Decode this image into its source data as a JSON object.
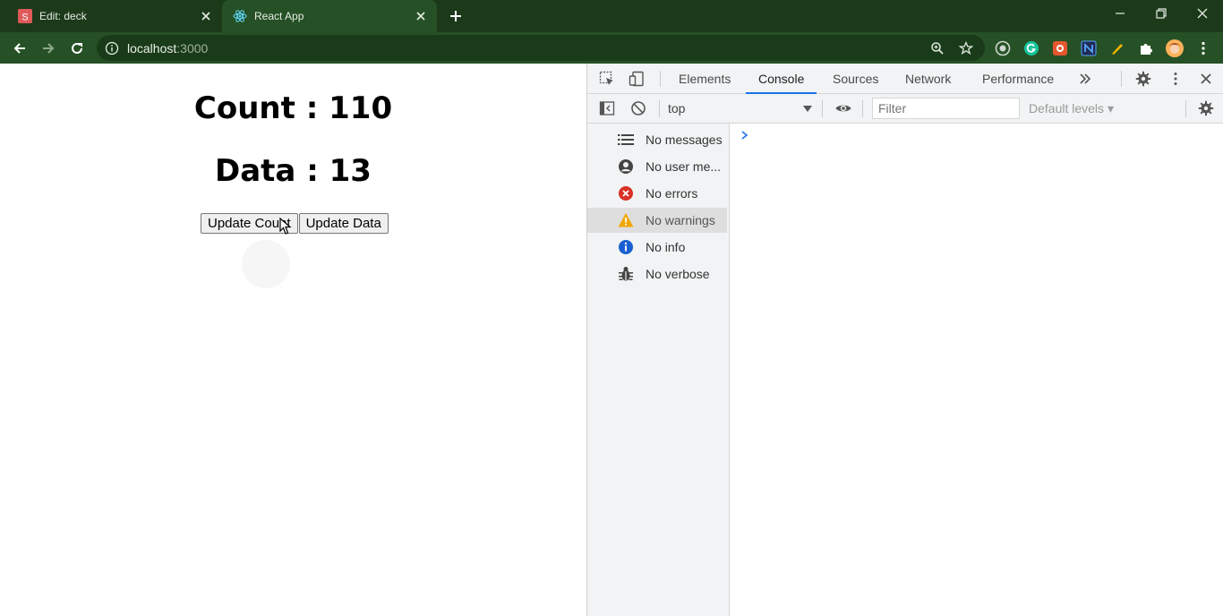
{
  "browser": {
    "tabs": [
      {
        "title": "Edit: deck",
        "favicon": "s-letter-icon",
        "favicon_letter": "S",
        "active": false
      },
      {
        "title": "React App",
        "favicon": "react-icon",
        "active": true
      }
    ],
    "address": {
      "host": "localhost",
      "port": ":3000"
    }
  },
  "app": {
    "count_heading": "Count : 110",
    "data_heading": "Data : 13",
    "buttons": {
      "update_count": "Update Count",
      "update_data": "Update Data"
    }
  },
  "devtools": {
    "tabs": [
      "Elements",
      "Console",
      "Sources",
      "Network",
      "Performance"
    ],
    "active_tab": "Console",
    "context": "top",
    "filter_placeholder": "Filter",
    "levels_label": "Default levels",
    "sidebar": [
      {
        "label": "No messages",
        "icon": "list-icon"
      },
      {
        "label": "No user me...",
        "icon": "user-icon"
      },
      {
        "label": "No errors",
        "icon": "error-icon"
      },
      {
        "label": "No warnings",
        "icon": "warning-icon",
        "selected": true
      },
      {
        "label": "No info",
        "icon": "info-icon"
      },
      {
        "label": "No verbose",
        "icon": "bug-icon"
      }
    ]
  },
  "colors": {
    "frame": "#1c3a1a",
    "toolbar": "#265126",
    "accent": "#1a73e8",
    "error": "#d93025",
    "warning": "#f2a600",
    "info": "#1a5fd0"
  }
}
